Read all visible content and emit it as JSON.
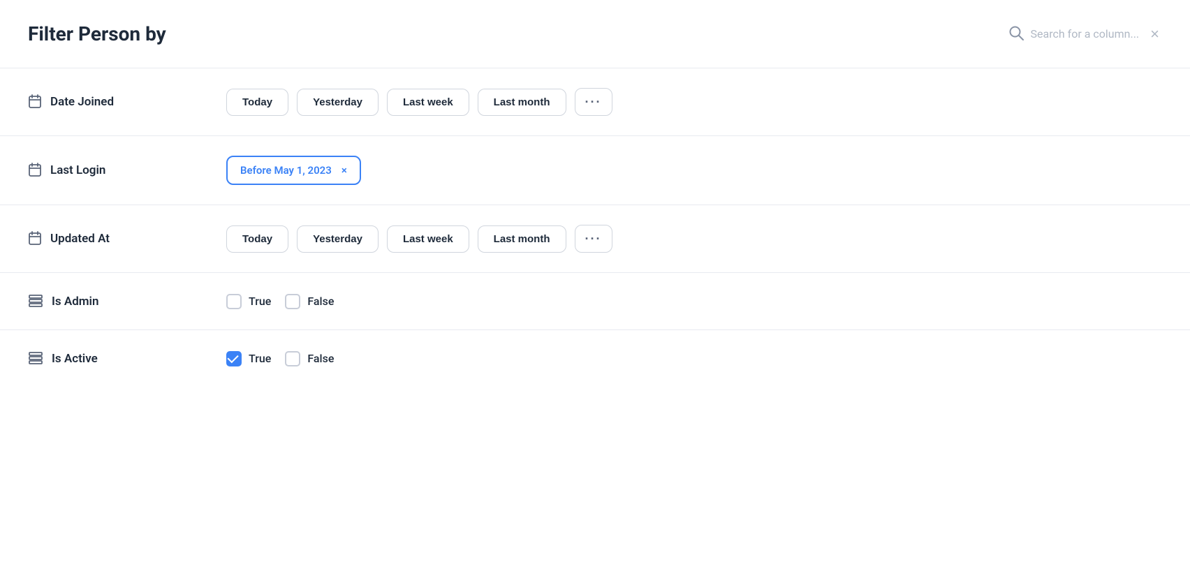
{
  "header": {
    "title": "Filter Person by",
    "search_placeholder": "Search for a column...",
    "close_label": "×"
  },
  "filters": [
    {
      "id": "date_joined",
      "label": "Date Joined",
      "icon_type": "calendar",
      "type": "date_buttons",
      "buttons": [
        "Today",
        "Yesterday",
        "Last week",
        "Last month"
      ],
      "active_filter": null
    },
    {
      "id": "last_login",
      "label": "Last Login",
      "icon_type": "calendar",
      "type": "active_tag",
      "active_filter": "Before May 1, 2023"
    },
    {
      "id": "updated_at",
      "label": "Updated At",
      "icon_type": "calendar",
      "type": "date_buttons",
      "buttons": [
        "Today",
        "Yesterday",
        "Last week",
        "Last month"
      ],
      "active_filter": null
    },
    {
      "id": "is_admin",
      "label": "Is Admin",
      "icon_type": "stack",
      "type": "boolean",
      "true_checked": false,
      "false_checked": false,
      "true_label": "True",
      "false_label": "False"
    },
    {
      "id": "is_active",
      "label": "Is Active",
      "icon_type": "stack",
      "type": "boolean",
      "true_checked": true,
      "false_checked": false,
      "true_label": "True",
      "false_label": "False"
    }
  ]
}
